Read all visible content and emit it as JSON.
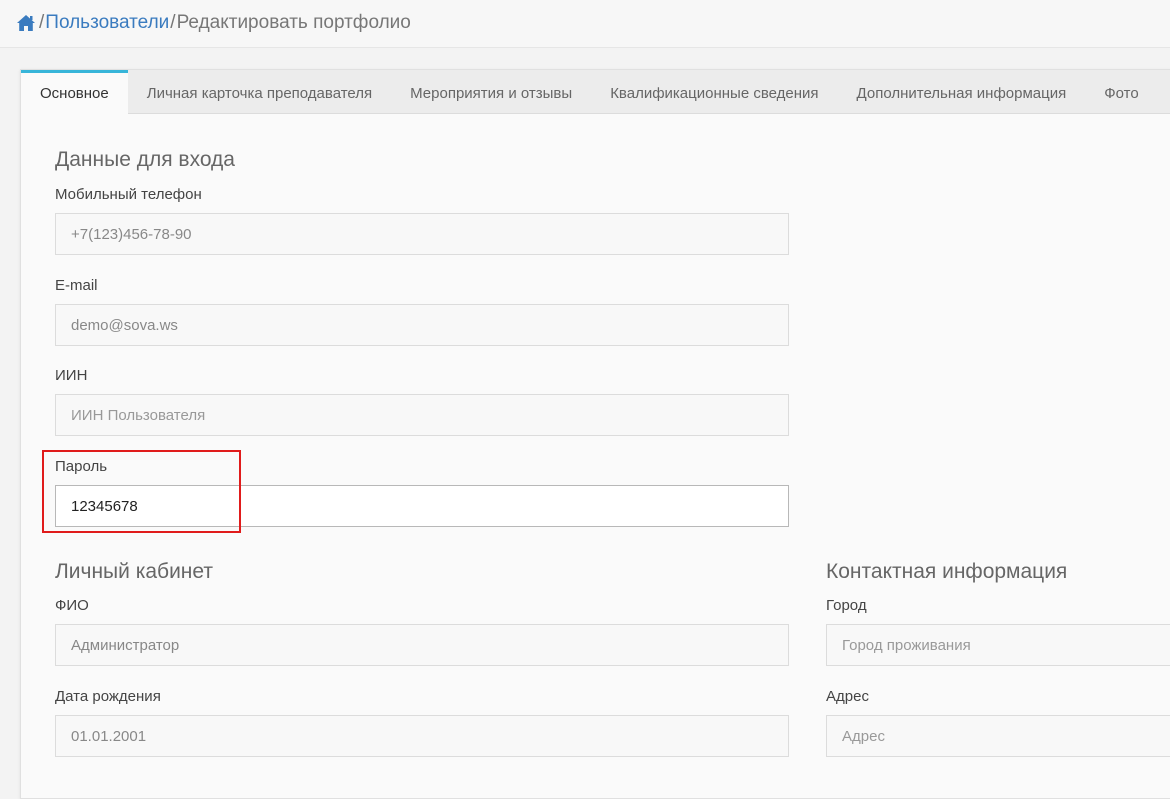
{
  "breadcrumb": {
    "home_icon": "home-icon",
    "separator": "/",
    "users_link": "Пользователи",
    "current": "Редактировать портфолио"
  },
  "tabs": [
    {
      "label": "Основное",
      "active": true
    },
    {
      "label": "Личная карточка преподавателя"
    },
    {
      "label": "Мероприятия и отзывы"
    },
    {
      "label": "Квалификационные сведения"
    },
    {
      "label": "Дополнительная информация"
    },
    {
      "label": "Фото"
    }
  ],
  "login_section": {
    "title": "Данные для входа",
    "phone": {
      "label": "Мобильный телефон",
      "value": "+7(123)456-78-90"
    },
    "email": {
      "label": "E-mail",
      "value": "demo@sova.ws"
    },
    "iin": {
      "label": "ИИН",
      "placeholder": "ИИН Пользователя"
    },
    "password": {
      "label": "Пароль",
      "value": "12345678"
    }
  },
  "cabinet_section": {
    "title": "Личный кабинет",
    "fio": {
      "label": "ФИО",
      "value": "Администратор"
    },
    "birthdate": {
      "label": "Дата рождения",
      "value": "01.01.2001"
    }
  },
  "contact_section": {
    "title": "Контактная информация",
    "city": {
      "label": "Город",
      "placeholder": "Город проживания"
    },
    "address": {
      "label": "Адрес",
      "placeholder": "Адрес"
    }
  },
  "colors": {
    "link": "#3a7bbf",
    "active_tab_border": "#37b5d9",
    "highlight": "#e01b1b"
  }
}
